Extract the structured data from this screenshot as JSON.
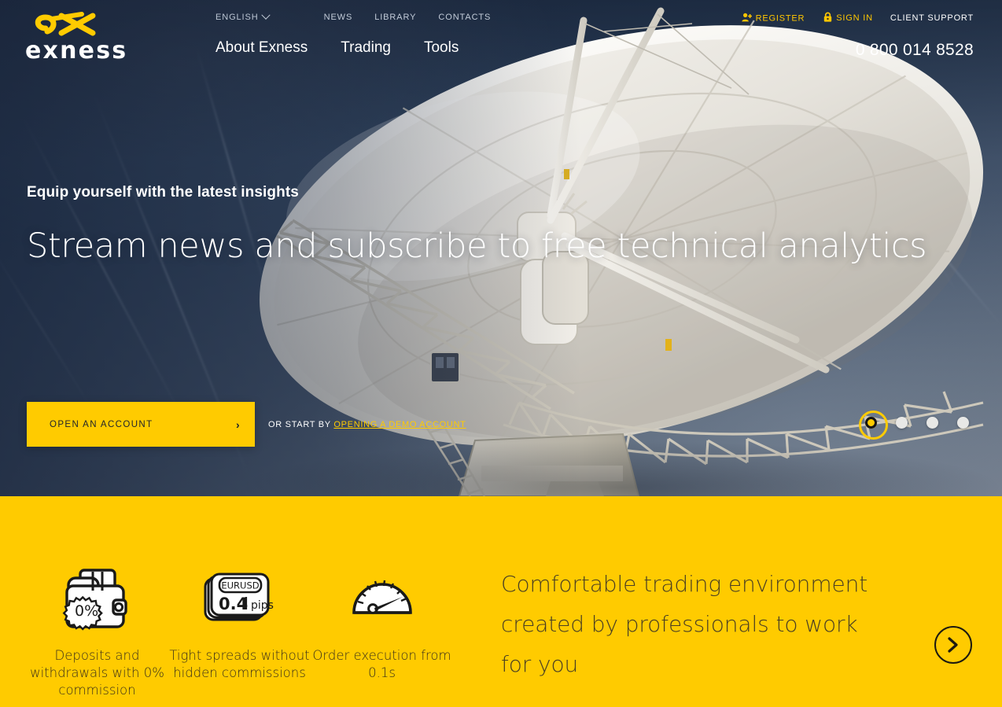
{
  "brand": {
    "name": "exness",
    "logo_mark": "ex-monogram-icon",
    "accent_color": "#ffcb00",
    "header_bg": "#1e2d45"
  },
  "header": {
    "language": {
      "label": "ENGLISH",
      "icon": "chevron-down-icon"
    },
    "util_links": [
      "NEWS",
      "LIBRARY",
      "CONTACTS"
    ],
    "main_nav": [
      "About Exness",
      "Trading",
      "Tools"
    ],
    "account": {
      "register": {
        "label": "REGISTER",
        "icon": "user-plus-icon"
      },
      "sign_in": {
        "label": "SIGN IN",
        "icon": "lock-icon"
      },
      "support": {
        "label": "CLIENT SUPPORT"
      }
    },
    "phone": "0 800 014 8528"
  },
  "hero": {
    "kicker": "Equip yourself with the latest insights",
    "title": "Stream news and subscribe to free technical analytics",
    "cta": {
      "label": "OPEN AN ACCOUNT",
      "icon": "chevron-right-icon"
    },
    "secondary": {
      "prefix": "OR START BY ",
      "link": "OPENING A DEMO ACCOUNT"
    },
    "carousel": {
      "total": 4,
      "active_index": 1
    },
    "background_image": "satellite-dish-photo"
  },
  "band": {
    "heading": "Comfortable trading environment created by professionals to work for you",
    "next_button_icon": "chevron-right-circle-icon",
    "features": [
      {
        "icon": "wallet-zero-percent-icon",
        "badge": "0%",
        "caption": "Deposits and withdrawals with 0% commission"
      },
      {
        "icon": "eurusd-spread-card-icon",
        "pair": "EURUSD",
        "value": "0.4",
        "unit": "pips",
        "caption": "Tight spreads without hidden commissions"
      },
      {
        "icon": "speedometer-icon",
        "caption": "Order execution from 0.1s"
      }
    ]
  }
}
